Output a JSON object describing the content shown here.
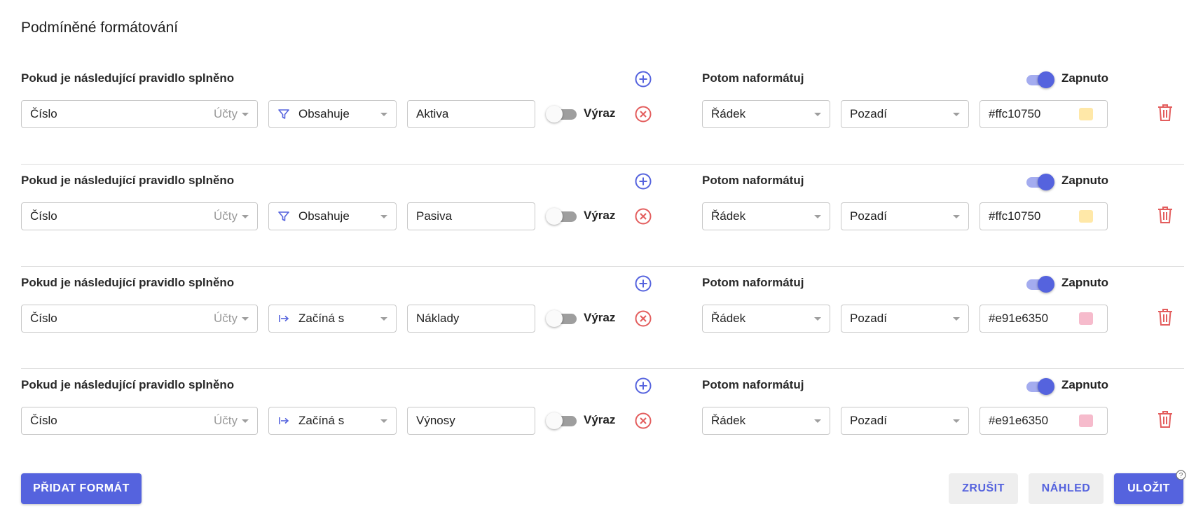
{
  "page_title": "Podmíněné formátování",
  "colors": {
    "accent": "#5563de",
    "danger": "#e35d5d"
  },
  "rules": [
    {
      "condition_label": "Pokud je následující pravidlo splněno",
      "field": {
        "value": "Číslo",
        "hint": "Účty"
      },
      "operator": {
        "icon": "filter-icon",
        "value": "Obsahuje"
      },
      "text_value": "Aktiva",
      "expression_label": "Výraz",
      "expression_on": false,
      "format_label": "Potom naformátuj",
      "enabled_label": "Zapnuto",
      "enabled": true,
      "target": "Řádek",
      "property": "Pozadí",
      "color_value": "#ffc10750",
      "swatch": "#ffe8a8"
    },
    {
      "condition_label": "Pokud je následující pravidlo splněno",
      "field": {
        "value": "Číslo",
        "hint": "Účty"
      },
      "operator": {
        "icon": "filter-icon",
        "value": "Obsahuje"
      },
      "text_value": "Pasiva",
      "expression_label": "Výraz",
      "expression_on": false,
      "format_label": "Potom naformátuj",
      "enabled_label": "Zapnuto",
      "enabled": true,
      "target": "Řádek",
      "property": "Pozadí",
      "color_value": "#ffc10750",
      "swatch": "#ffe8a8"
    },
    {
      "condition_label": "Pokud je následující pravidlo splněno",
      "field": {
        "value": "Číslo",
        "hint": "Účty"
      },
      "operator": {
        "icon": "starts-with-icon",
        "value": "Začíná s"
      },
      "text_value": "Náklady",
      "expression_label": "Výraz",
      "expression_on": false,
      "format_label": "Potom naformátuj",
      "enabled_label": "Zapnuto",
      "enabled": true,
      "target": "Řádek",
      "property": "Pozadí",
      "color_value": "#e91e6350",
      "swatch": "#f6bbcc"
    },
    {
      "condition_label": "Pokud je následující pravidlo splněno",
      "field": {
        "value": "Číslo",
        "hint": "Účty"
      },
      "operator": {
        "icon": "starts-with-icon",
        "value": "Začíná s"
      },
      "text_value": "Výnosy",
      "expression_label": "Výraz",
      "expression_on": false,
      "format_label": "Potom naformátuj",
      "enabled_label": "Zapnuto",
      "enabled": true,
      "target": "Řádek",
      "property": "Pozadí",
      "color_value": "#e91e6350",
      "swatch": "#f6bbcc"
    }
  ],
  "footer": {
    "add_format": "PŘIDAT FORMÁT",
    "cancel": "ZRUŠIT",
    "preview": "NÁHLED",
    "save": "ULOŽIT",
    "help_icon": "help-icon"
  }
}
